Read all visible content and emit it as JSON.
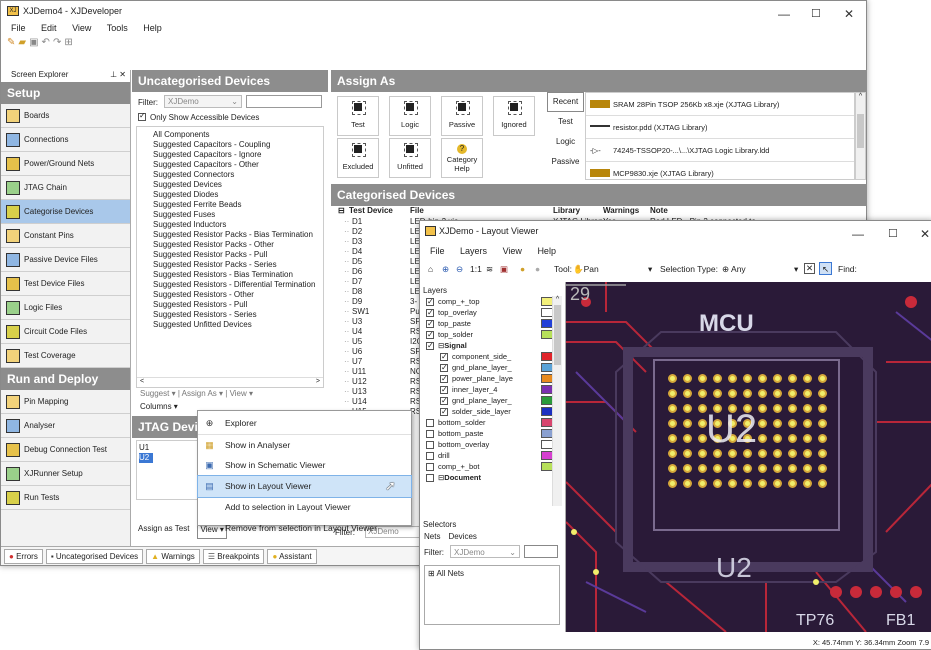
{
  "main_window": {
    "title": "XJDemo4 - XJDeveloper",
    "menu": [
      "File",
      "Edit",
      "View",
      "Tools",
      "Help"
    ],
    "controls": [
      "—",
      "☐",
      "✕"
    ]
  },
  "explorer": {
    "title": "Screen Explorer",
    "pin": "⊥ ✕",
    "setup_header": "Setup",
    "setup_items": [
      {
        "label": "Boards",
        "icon": "boards-icon"
      },
      {
        "label": "Connections",
        "icon": "connections-icon"
      },
      {
        "label": "Power/Ground Nets",
        "icon": "power-icon"
      },
      {
        "label": "JTAG Chain",
        "icon": "jtag-icon"
      },
      {
        "label": "Categorise Devices",
        "icon": "categorise-icon"
      },
      {
        "label": "Constant Pins",
        "icon": "constant-icon"
      },
      {
        "label": "Passive Device Files",
        "icon": "passive-icon"
      },
      {
        "label": "Test Device Files",
        "icon": "testdev-icon"
      },
      {
        "label": "Logic Files",
        "icon": "logic-icon"
      },
      {
        "label": "Circuit Code Files",
        "icon": "circuit-icon"
      },
      {
        "label": "Test Coverage",
        "icon": "coverage-icon"
      }
    ],
    "run_header": "Run and Deploy",
    "run_items": [
      {
        "label": "Pin Mapping",
        "icon": "pin-mapping-icon"
      },
      {
        "label": "Analyser",
        "icon": "analyser-icon"
      },
      {
        "label": "Debug Connection Test",
        "icon": "debug-icon"
      },
      {
        "label": "XJRunner Setup",
        "icon": "runner-icon"
      },
      {
        "label": "Run Tests",
        "icon": "run-icon"
      }
    ]
  },
  "uncategorised": {
    "header": "Uncategorised Devices",
    "filter_label": "Filter:",
    "filter_value": "XJDemo",
    "only_show": "Only Show Accessible Devices",
    "items": [
      "All Components",
      "Suggested Capacitors - Coupling",
      "Suggested Capacitors - Ignore",
      "Suggested Capacitors - Other",
      "Suggested Connectors",
      "Suggested Devices",
      "Suggested Diodes",
      "Suggested Ferrite Beads",
      "Suggested Fuses",
      "Suggested Inductors",
      "Suggested Resistor Packs - Bias Termination",
      "Suggested Resistor Packs - Other",
      "Suggested Resistor Packs - Pull",
      "Suggested Resistor Packs - Series",
      "Suggested Resistors - Bias Termination",
      "Suggested Resistors - Differential Termination",
      "Suggested Resistors - Other",
      "Suggested Resistors - Pull",
      "Suggested Resistors - Series",
      "Suggested Unfitted Devices"
    ],
    "toolbar": "Suggest ▾ | Assign As ▾ | View ▾",
    "columns": "Columns ▾"
  },
  "jtag_devices": {
    "header": "JTAG Devices",
    "items": [
      "U1",
      "U2"
    ],
    "assign_btn": "Assign as Test",
    "view_btn": "View ▾"
  },
  "assign_as": {
    "header": "Assign As",
    "buttons": [
      "Test",
      "Logic",
      "Passive",
      "Ignored",
      "Excluded",
      "Unfitted",
      "Category Help"
    ],
    "tabs": [
      "Recent",
      "Test",
      "Logic",
      "Passive"
    ],
    "library": [
      "SRAM 28Pin TSOP 256Kb x8.xje (XJTAG Library)",
      "resistor.pdd (XJTAG Library)",
      "74245-TSSOP20-...\\...\\XJTAG Logic Library.ldd",
      "MCP9830.xje (XJTAG Library)"
    ]
  },
  "categorised": {
    "header": "Categorised Devices",
    "cols": [
      "Test Device",
      "File",
      "Library",
      "Warnings",
      "Note"
    ],
    "rows": [
      {
        "dev": "D1",
        "file": "LED-bin-2.xje",
        "lib": "XJTAG Library",
        "warn": "Yes",
        "note": "Red LED - Pin 2 connected to"
      },
      {
        "dev": "D2",
        "file": "LE"
      },
      {
        "dev": "D3",
        "file": "LE"
      },
      {
        "dev": "D4",
        "file": "LE"
      },
      {
        "dev": "D5",
        "file": "LE"
      },
      {
        "dev": "D6",
        "file": "LE"
      },
      {
        "dev": "D7",
        "file": "LE"
      },
      {
        "dev": "D8",
        "file": "LE"
      },
      {
        "dev": "D9",
        "file": "3-"
      },
      {
        "dev": "SW1",
        "file": "Pu"
      },
      {
        "dev": "U3",
        "file": "SF"
      },
      {
        "dev": "U4",
        "file": "RS"
      },
      {
        "dev": "U5",
        "file": "I2C"
      },
      {
        "dev": "U6",
        "file": "SF"
      },
      {
        "dev": "U7",
        "file": "RS"
      },
      {
        "dev": "U11",
        "file": "NC"
      },
      {
        "dev": "U12",
        "file": "RS"
      },
      {
        "dev": "U13",
        "file": "RS"
      },
      {
        "dev": "U14",
        "file": "RS"
      },
      {
        "dev": "U15",
        "file": "RS"
      }
    ],
    "filter_label": "Filter:",
    "filter_value": "XJDemo"
  },
  "context_menu": {
    "items": [
      {
        "label": "Explorer",
        "icon": "⊕"
      },
      {
        "label": "Show in Analyser",
        "icon": "▦"
      },
      {
        "label": "Show in Schematic Viewer",
        "icon": "▣"
      },
      {
        "label": "Show in Layout Viewer",
        "icon": "▤"
      },
      {
        "label": "Add to selection in Layout Viewer",
        "icon": ""
      },
      {
        "label": "Remove from selection in Layout Viewer",
        "icon": ""
      }
    ]
  },
  "status_tabs": [
    "Errors",
    "Uncategorised Devices",
    "Warnings",
    "Breakpoints",
    "Assistant"
  ],
  "layout_viewer": {
    "title": "XJDemo - Layout Viewer",
    "menu": [
      "File",
      "Layers",
      "View",
      "Help"
    ],
    "tool_label": "Tool:",
    "tool_value": "Pan",
    "selection_label": "Selection Type:",
    "selection_value": "Any",
    "find_label": "Find:",
    "layers_header": "Layers",
    "layers": [
      {
        "name": "comp_+_top",
        "on": true,
        "color": "#f3f07a",
        "indent": 0
      },
      {
        "name": "top_overlay",
        "on": true,
        "color": "#ffffff",
        "indent": 0
      },
      {
        "name": "top_paste",
        "on": true,
        "color": "#2340d8",
        "indent": 0
      },
      {
        "name": "top_solder",
        "on": true,
        "color": "#b7e05a",
        "indent": 0
      },
      {
        "name": "Signal",
        "on": true,
        "color": "",
        "indent": 0,
        "group": true
      },
      {
        "name": "component_side_",
        "on": true,
        "color": "#e0242a",
        "indent": 1
      },
      {
        "name": "gnd_plane_layer_",
        "on": true,
        "color": "#5aa3d8",
        "indent": 1
      },
      {
        "name": "power_plane_laye",
        "on": true,
        "color": "#e88a1e",
        "indent": 1
      },
      {
        "name": "inner_layer_4",
        "on": true,
        "color": "#7b2fb0",
        "indent": 1
      },
      {
        "name": "gnd_plane_layer_",
        "on": true,
        "color": "#2a9a3a",
        "indent": 1
      },
      {
        "name": "solder_side_layer",
        "on": true,
        "color": "#1c2fc0",
        "indent": 1
      },
      {
        "name": "bottom_solder",
        "on": false,
        "color": "#d8456e",
        "indent": 0
      },
      {
        "name": "bottom_paste",
        "on": false,
        "color": "#8aa0d0",
        "indent": 0
      },
      {
        "name": "bottom_overlay",
        "on": false,
        "color": "#ffffff",
        "indent": 0
      },
      {
        "name": "drill",
        "on": false,
        "color": "#d63fd0",
        "indent": 0
      },
      {
        "name": "comp_+_bot",
        "on": false,
        "color": "#b7e05a",
        "indent": 0
      },
      {
        "name": "Document",
        "on": false,
        "color": "",
        "indent": 0,
        "group": true
      }
    ],
    "selectors_header": "Selectors",
    "sel_tabs": [
      "Nets",
      "Devices"
    ],
    "sel_filter_label": "Filter:",
    "sel_filter_value": "XJDemo",
    "all_nets": "All Nets",
    "pcb_labels": [
      "MCU",
      "U2",
      "U2",
      "TP76",
      "FB1",
      "29"
    ],
    "status": "X: 45.74mm  Y: 36.34mm  Zoom 7.9"
  }
}
